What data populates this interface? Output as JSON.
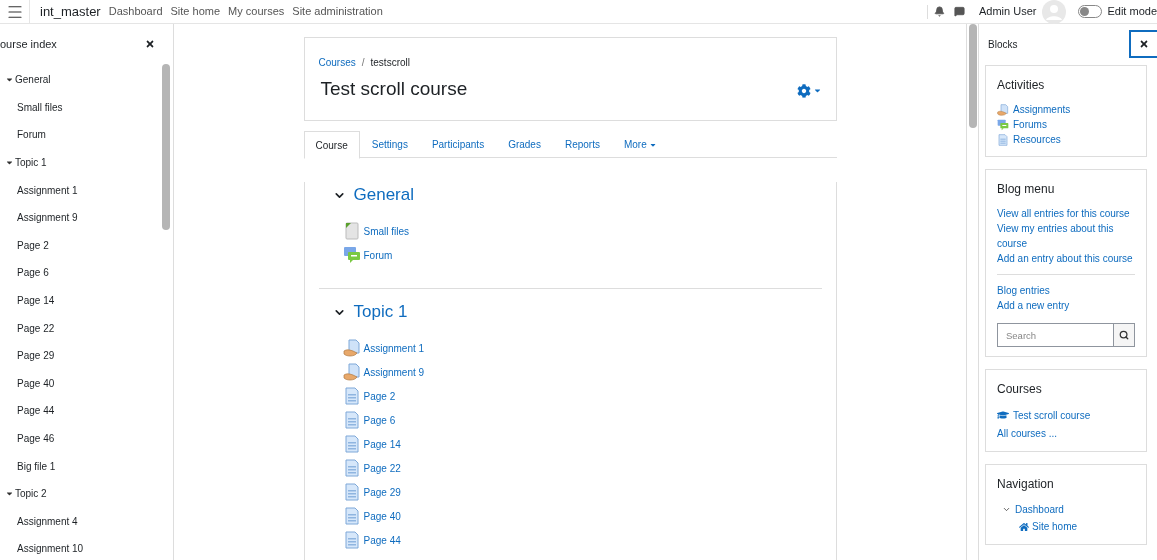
{
  "topbar": {
    "site_name": "int_master",
    "nav": [
      "Dashboard",
      "Site home",
      "My courses",
      "Site administration"
    ],
    "user_name": "Admin User",
    "edit_mode": {
      "label": "Edit mode",
      "on": false
    }
  },
  "course_index": {
    "title": "ourse index",
    "sections": [
      {
        "label": "General",
        "expanded": true,
        "children": [
          {
            "label": "Small files"
          },
          {
            "label": "Forum"
          }
        ]
      },
      {
        "label": "Topic 1",
        "expanded": true,
        "children": [
          {
            "label": "Assignment 1"
          },
          {
            "label": "Assignment 9"
          },
          {
            "label": "Page 2"
          },
          {
            "label": "Page 6"
          },
          {
            "label": "Page 14"
          },
          {
            "label": "Page 22"
          },
          {
            "label": "Page 29"
          },
          {
            "label": "Page 40"
          },
          {
            "label": "Page 44"
          },
          {
            "label": "Page 46"
          },
          {
            "label": "Big file 1"
          }
        ]
      },
      {
        "label": "Topic 2",
        "expanded": true,
        "children": [
          {
            "label": "Assignment 4"
          },
          {
            "label": "Assignment 10"
          }
        ]
      }
    ]
  },
  "course": {
    "breadcrumb": [
      "Courses",
      "testscroll"
    ],
    "breadcrumb_separator": "/",
    "title": "Test scroll course",
    "tabs": [
      {
        "label": "Course",
        "selected": true,
        "has_menu": false
      },
      {
        "label": "Settings",
        "selected": false,
        "has_menu": false
      },
      {
        "label": "Participants",
        "selected": false,
        "has_menu": false
      },
      {
        "label": "Grades",
        "selected": false,
        "has_menu": false
      },
      {
        "label": "Reports",
        "selected": false,
        "has_menu": false
      },
      {
        "label": "More",
        "selected": false,
        "has_menu": true
      }
    ],
    "sections": [
      {
        "title": "General",
        "expanded": true,
        "activities": [
          {
            "kind": "file",
            "label": "Small files"
          },
          {
            "kind": "forum",
            "label": "Forum"
          }
        ]
      },
      {
        "title": "Topic 1",
        "expanded": true,
        "activities": [
          {
            "kind": "assignment",
            "label": "Assignment 1"
          },
          {
            "kind": "assignment",
            "label": "Assignment 9"
          },
          {
            "kind": "page",
            "label": "Page 2"
          },
          {
            "kind": "page",
            "label": "Page 6"
          },
          {
            "kind": "page",
            "label": "Page 14"
          },
          {
            "kind": "page",
            "label": "Page 22"
          },
          {
            "kind": "page",
            "label": "Page 29"
          },
          {
            "kind": "page",
            "label": "Page 40"
          },
          {
            "kind": "page",
            "label": "Page 44"
          }
        ]
      }
    ]
  },
  "blocks": {
    "title": "Blocks",
    "cards": [
      {
        "kind": "activities",
        "title": "Activities",
        "items": [
          {
            "kind": "assignment",
            "label": "Assignments"
          },
          {
            "kind": "forum",
            "label": "Forums"
          },
          {
            "kind": "page",
            "label": "Resources"
          }
        ]
      },
      {
        "kind": "blog",
        "title": "Blog menu",
        "links": [
          "View all entries for this course",
          "View my entries about this course",
          "Add an entry about this course"
        ],
        "entry_links": [
          "Blog entries",
          "Add a new entry"
        ],
        "search": {
          "placeholder": "Search"
        }
      },
      {
        "kind": "courses",
        "title": "Courses",
        "courses": [
          "Test scroll course"
        ],
        "all_link": "All courses ..."
      },
      {
        "kind": "navigation",
        "title": "Navigation",
        "tree": [
          {
            "label": "Dashboard",
            "expanded": true,
            "children": [
              {
                "label": "Site home"
              }
            ]
          }
        ]
      }
    ]
  }
}
